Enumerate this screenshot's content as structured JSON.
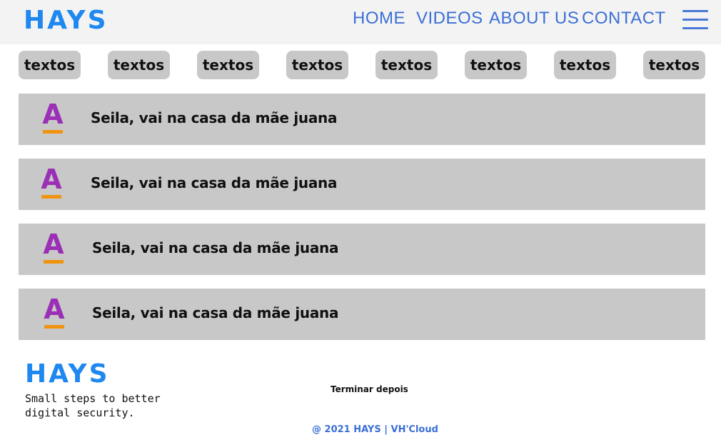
{
  "header": {
    "brand": "HAYS",
    "nav": [
      "HOME",
      "VIDEOS",
      "ABOUT US",
      "CONTACT"
    ],
    "menu_icon": "hamburger-icon"
  },
  "chips": [
    "textos",
    "textos",
    "textos",
    "textos",
    "textos",
    "textos",
    "textos",
    "textos"
  ],
  "cards": [
    {
      "avatar": "A",
      "text": "Seila, vai na casa da mãe juana"
    },
    {
      "avatar": "A",
      "text": "Seila, vai na casa da mãe juana"
    },
    {
      "avatar": "A",
      "text": "Seila, vai na casa da mãe juana"
    },
    {
      "avatar": "A",
      "text": "Seila, vai na casa da mãe juana"
    }
  ],
  "footer": {
    "brand": "HAYS",
    "tagline": "Small steps to better digital security.",
    "note": "Terminar depois",
    "copyright": "@ 2021 HAYS | VH'Cloud"
  },
  "colors": {
    "brand": "#1e88f0",
    "nav": "#3b6fd6",
    "chip_bg": "#c8c8c8",
    "card_bg": "#c8c8c8",
    "avatar_letter": "#9b2fb6",
    "avatar_underline": "#f0940f"
  }
}
